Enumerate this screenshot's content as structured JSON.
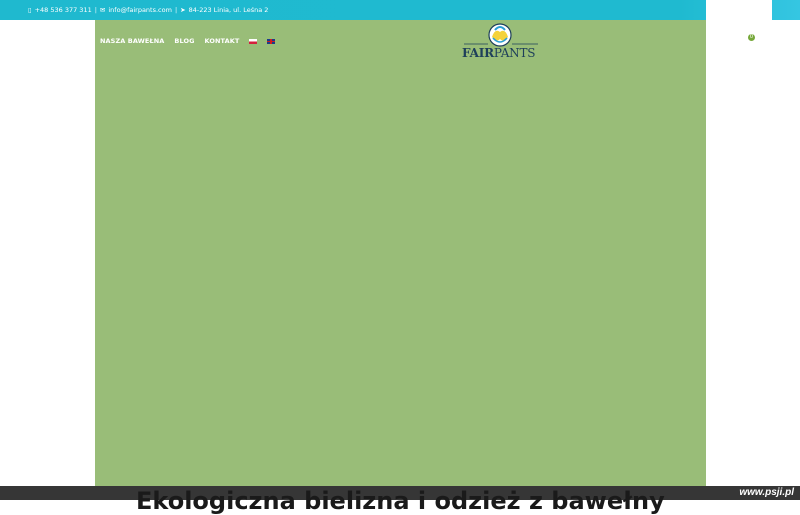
{
  "topbar": {
    "phone_icon": "phone-icon",
    "phone": "+48 536 377 311",
    "separator": "|",
    "email_icon": "envelope-icon",
    "email": "info@fairpants.com",
    "location_icon": "location-arrow-icon",
    "address": "84-223 Linia, ul. Leśna 2"
  },
  "nav": {
    "items": [
      {
        "label": "NASZA BAWEŁNA"
      },
      {
        "label": "BLOG"
      },
      {
        "label": "KONTAKT"
      }
    ],
    "lang_pl": "flag-pl-icon",
    "lang_en": "flag-en-icon"
  },
  "logo": {
    "text_fair": "FAIR",
    "text_pants": "PANTS"
  },
  "cart": {
    "count": "0"
  },
  "hero": {
    "headline": "Ekologiczna bielizna i odzież z bawełny"
  },
  "watermark": "www.psji.pl",
  "colors": {
    "topbar": "#1fb9cf",
    "hero": "#99bd78",
    "cart_badge": "#76a83a",
    "logo_text": "#1e3f5a"
  }
}
